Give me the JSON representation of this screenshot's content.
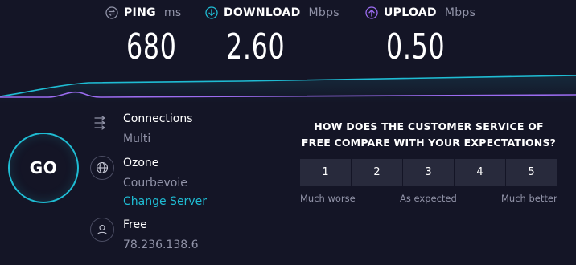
{
  "stats": {
    "ping": {
      "label": "PING",
      "unit": "ms",
      "value": "680",
      "icon": "ping-icon",
      "color": "#9193a8"
    },
    "download": {
      "label": "DOWNLOAD",
      "unit": "Mbps",
      "value": "2.60",
      "icon": "download-arrow-icon",
      "color": "#1fbcd3"
    },
    "upload": {
      "label": "UPLOAD",
      "unit": "Mbps",
      "value": "0.50",
      "icon": "upload-arrow-icon",
      "color": "#9b6cf0"
    }
  },
  "go_label": "GO",
  "info": {
    "connections": {
      "title": "Connections",
      "value": "Multi",
      "icon": "connections-icon"
    },
    "server": {
      "title": "Ozone",
      "location": "Courbevoie",
      "change_label": "Change Server",
      "icon": "globe-icon"
    },
    "provider": {
      "title": "Free",
      "ip": "78.236.138.6",
      "icon": "user-icon"
    }
  },
  "survey": {
    "question": "HOW DOES THE CUSTOMER SERVICE OF FREE COMPARE WITH YOUR EXPECTATIONS?",
    "options": [
      "1",
      "2",
      "3",
      "4",
      "5"
    ],
    "labels": {
      "low": "Much worse",
      "mid": "As expected",
      "high": "Much better"
    }
  },
  "colors": {
    "background": "#141526",
    "accent": "#1fbcd3",
    "upload": "#9b6cf0",
    "muted": "#9193a8",
    "button_bg": "#282a3c"
  }
}
